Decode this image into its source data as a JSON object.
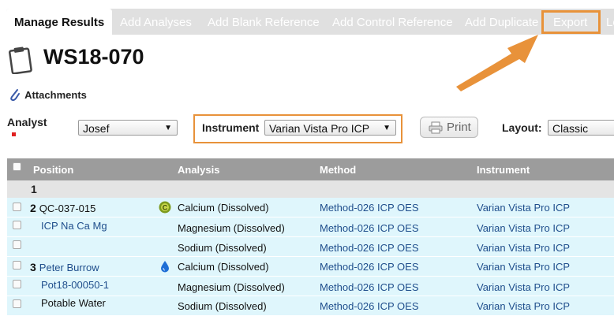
{
  "tabs": [
    {
      "label": "Manage Results",
      "active": true
    },
    {
      "label": "Add Analyses"
    },
    {
      "label": "Add Blank Reference"
    },
    {
      "label": "Add Control Reference"
    },
    {
      "label": "Add Duplicate"
    },
    {
      "label": "Export"
    },
    {
      "label": "Lo"
    }
  ],
  "page": {
    "title": "WS18-070",
    "attachments_label": "Attachments"
  },
  "filters": {
    "analyst_label": "Analyst",
    "analyst_value": "Josef",
    "instrument_label": "Instrument",
    "instrument_value": "Varian Vista Pro ICP",
    "print_label": "Print",
    "layout_label": "Layout:",
    "layout_value": "Classic"
  },
  "table": {
    "headers": [
      "Position",
      "Analysis",
      "Method",
      "Instrument"
    ],
    "group_number": "1",
    "rows": [
      {
        "num": "2",
        "position": "QC-037-015",
        "position_style": "dark",
        "icon": "control-icon",
        "analysis": "Calcium (Dissolved)",
        "method": "Method-026 ICP OES",
        "instrument": "Varian Vista Pro ICP"
      },
      {
        "num": "",
        "position": "ICP Na Ca Mg",
        "position_style": "link",
        "icon": "",
        "analysis": "Magnesium (Dissolved)",
        "method": "Method-026 ICP OES",
        "instrument": "Varian Vista Pro ICP"
      },
      {
        "num": "",
        "position": "",
        "position_style": "dark",
        "icon": "",
        "analysis": "Sodium (Dissolved)",
        "method": "Method-026 ICP OES",
        "instrument": "Varian Vista Pro ICP"
      },
      {
        "num": "3",
        "position": "Peter Burrow",
        "position_style": "link",
        "icon": "water-drop-icon",
        "analysis": "Calcium (Dissolved)",
        "method": "Method-026 ICP OES",
        "instrument": "Varian Vista Pro ICP"
      },
      {
        "num": "",
        "position": "Pot18-00050-1",
        "position_style": "link",
        "icon": "",
        "analysis": "Magnesium (Dissolved)",
        "method": "Method-026 ICP OES",
        "instrument": "Varian Vista Pro ICP"
      },
      {
        "num": "",
        "position": "Potable Water",
        "position_style": "dark",
        "icon": "",
        "analysis": "Sodium (Dissolved)",
        "method": "Method-026 ICP OES",
        "instrument": "Varian Vista Pro ICP"
      }
    ]
  },
  "colors": {
    "highlight": "#e8923a",
    "row_bg": "#dff6fc",
    "header_bg": "#9c9c9c",
    "link": "#1f4e8c"
  }
}
